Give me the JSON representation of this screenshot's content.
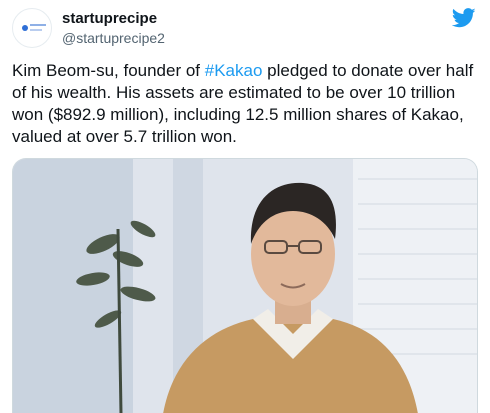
{
  "tweet": {
    "author_name": "startuprecipe",
    "author_handle": "@startuprecipe2",
    "text_before": "Kim Beom-su, founder of ",
    "hashtag": "#Kakao",
    "text_after": " pledged to donate over half of his wealth. His assets are estimated to be over 10 trillion won ($892.9 million), including 12.5 million shares of Kakao, valued at over 5.7 trillion won.",
    "icons": {
      "logo": "twitter-bird-icon",
      "avatar": "startuprecipe-logo"
    },
    "colors": {
      "link": "#1d9bf0",
      "brand": "#1d9bf0"
    }
  }
}
